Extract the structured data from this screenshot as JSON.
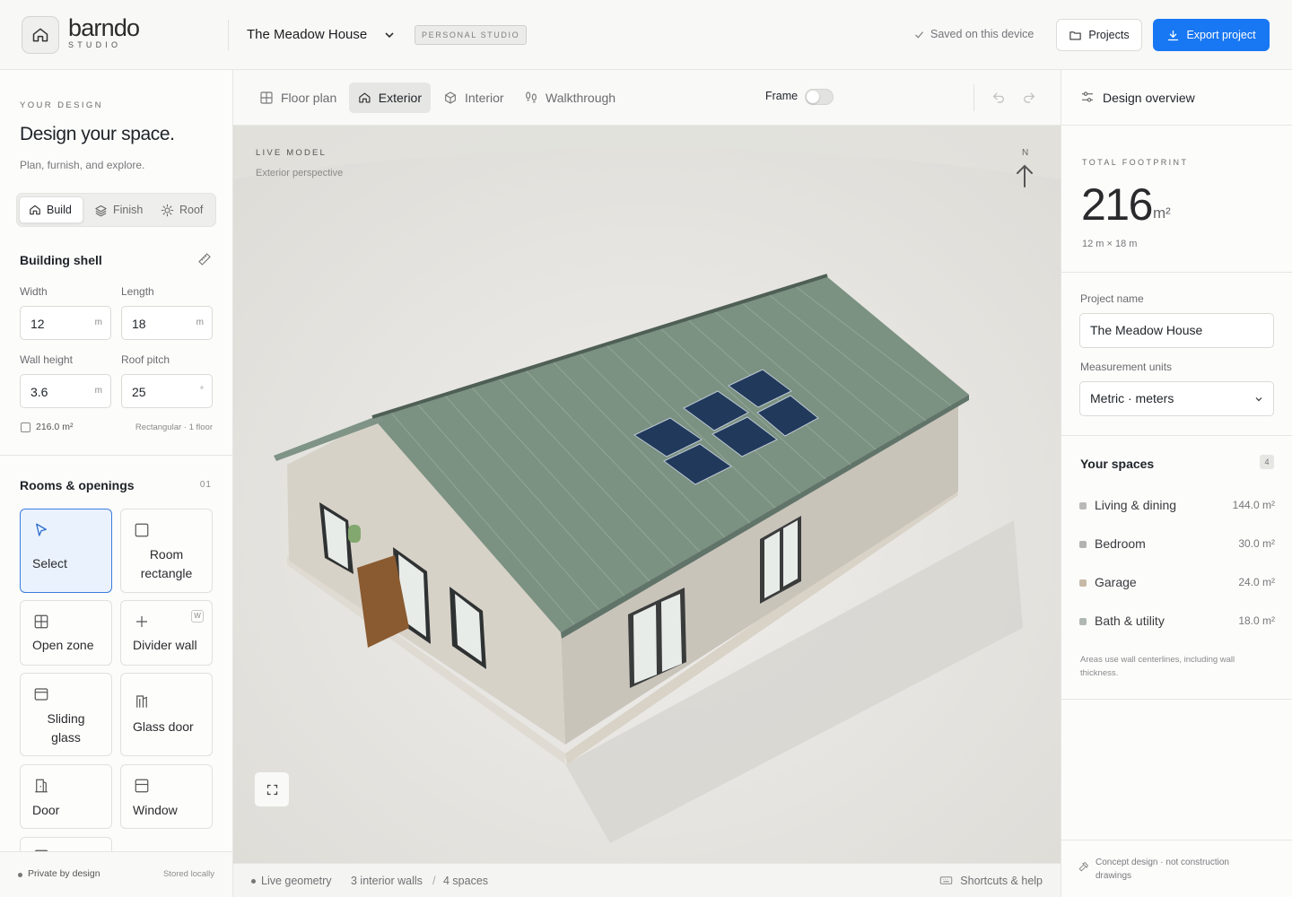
{
  "app": {
    "brand": "barndo",
    "brand_sub": "STUDIO"
  },
  "header": {
    "project_title": "The Meadow House",
    "badge": "PERSONAL STUDIO",
    "saved_status": "Saved on this device",
    "projects_label": "Projects",
    "export_label": "Export project"
  },
  "left": {
    "eyebrow": "YOUR DESIGN",
    "heading": "Design your space.",
    "subheading": "Plan, furnish, and explore.",
    "modes": [
      {
        "label": "Build",
        "icon": "home-icon",
        "active": true
      },
      {
        "label": "Finish",
        "icon": "layers-icon"
      },
      {
        "label": "Roof",
        "icon": "sun-icon"
      }
    ],
    "shell": {
      "title": "Building shell",
      "width_label": "Width",
      "width_value": "12",
      "width_unit": "m",
      "length_label": "Length",
      "length_value": "18",
      "length_unit": "m",
      "wall_height_label": "Wall height",
      "wall_height_value": "3.6",
      "wall_height_unit": "m",
      "roof_pitch_label": "Roof pitch",
      "roof_pitch_value": "25",
      "roof_pitch_unit": "°",
      "area": "216.0 m²",
      "shape": "Rectangular · 1 floor"
    },
    "rooms": {
      "title": "Rooms & openings",
      "count": "01",
      "tools": [
        {
          "label": "Select",
          "icon": "cursor-icon",
          "active": true
        },
        {
          "label": "Room rectangle",
          "icon": "square-icon"
        },
        {
          "label": "Open zone",
          "icon": "grid-icon"
        },
        {
          "label": "Divider wall",
          "icon": "plus-icon",
          "shortcut": "W"
        },
        {
          "label": "Sliding glass",
          "icon": "panel-icon"
        },
        {
          "label": "Glass door",
          "icon": "glass-door-icon"
        },
        {
          "label": "Door",
          "icon": "door-icon"
        },
        {
          "label": "Window",
          "icon": "window-icon"
        }
      ]
    },
    "footer": {
      "privacy": "Private by design",
      "storage": "Stored locally"
    }
  },
  "viewer": {
    "tabs": [
      {
        "label": "Floor plan",
        "icon": "floorplan-icon"
      },
      {
        "label": "Exterior",
        "icon": "home-icon",
        "active": true
      },
      {
        "label": "Interior",
        "icon": "cube-icon"
      },
      {
        "label": "Walkthrough",
        "icon": "footsteps-icon"
      }
    ],
    "frame_label": "Frame",
    "frame_on": false,
    "model_label": "LIVE MODEL",
    "model_sub": "Exterior perspective",
    "compass": "N",
    "status": {
      "live": "Live geometry",
      "walls": "3 interior walls",
      "sep": "/",
      "spaces": "4 spaces",
      "help": "Shortcuts & help"
    }
  },
  "right": {
    "title": "Design overview",
    "footprint_label": "TOTAL FOOTPRINT",
    "footprint_value": "216",
    "footprint_unit": "m²",
    "footprint_dims": "12 m × 18 m",
    "project_name_label": "Project name",
    "project_name_value": "The Meadow House",
    "units_label": "Measurement units",
    "units_value": "Metric · meters",
    "spaces_title": "Your spaces",
    "spaces_count": "4",
    "spaces": [
      {
        "name": "Living & dining",
        "area": "144.0 m²",
        "color": "#b9b9b6"
      },
      {
        "name": "Bedroom",
        "area": "30.0 m²",
        "color": "#b3b3b1"
      },
      {
        "name": "Garage",
        "area": "24.0 m²",
        "color": "#c7b9a6"
      },
      {
        "name": "Bath & utility",
        "area": "18.0 m²",
        "color": "#b0b8b3"
      }
    ],
    "spaces_note": "Areas use wall centerlines, including wall thickness.",
    "footer_note": "Concept design · not construction drawings"
  },
  "colors": {
    "accent": "#1877f2",
    "roof": "#7b9181",
    "walls": "#cfcac0",
    "door": "#8a5a30",
    "solar": "#21395a"
  }
}
